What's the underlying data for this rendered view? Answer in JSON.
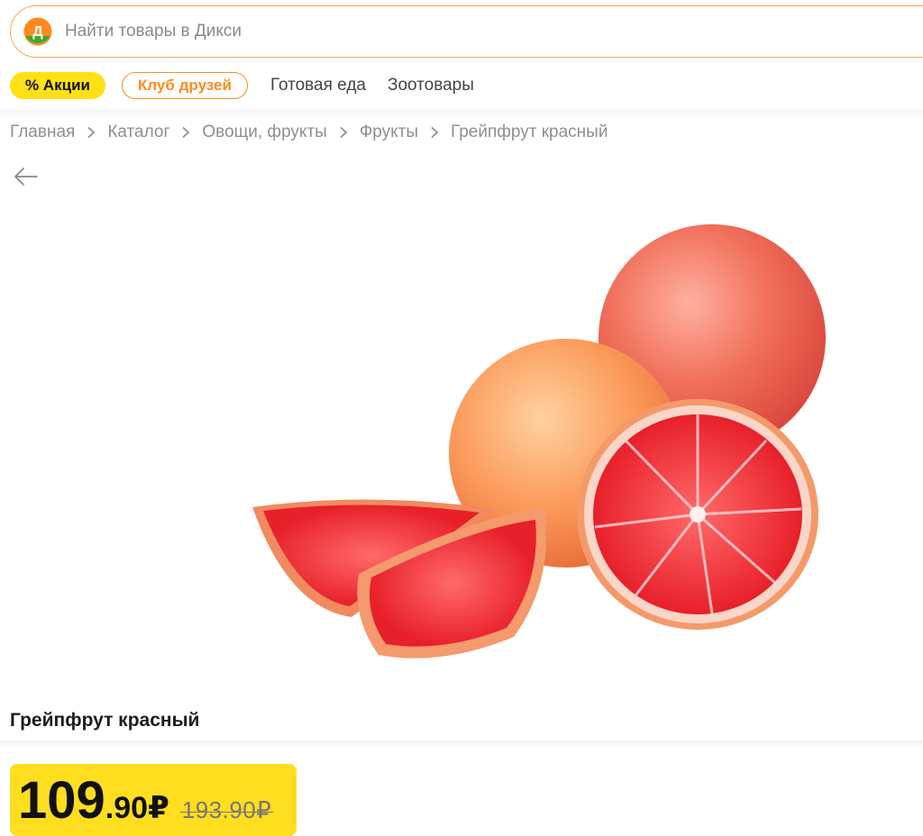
{
  "search": {
    "placeholder": "Найти товары в Дикси",
    "logo_letter": "Д"
  },
  "nav": {
    "promo_label": "% Акции",
    "club_label": "Клуб друзей",
    "links": [
      "Готовая еда",
      "Зоотовары"
    ]
  },
  "breadcrumbs": [
    "Главная",
    "Каталог",
    "Овощи, фрукты",
    "Фрукты",
    "Грейпфрут красный"
  ],
  "product": {
    "title": "Грейпфрут красный",
    "image_subject": "red grapefruit, whole and sliced"
  },
  "price": {
    "whole": "109",
    "dot": ".",
    "cents": "90",
    "currency": "₽",
    "old": "193.90₽"
  },
  "colors": {
    "accent_yellow": "#ffe014",
    "accent_orange": "#ff8a1e",
    "search_border": "#f4a85a"
  }
}
